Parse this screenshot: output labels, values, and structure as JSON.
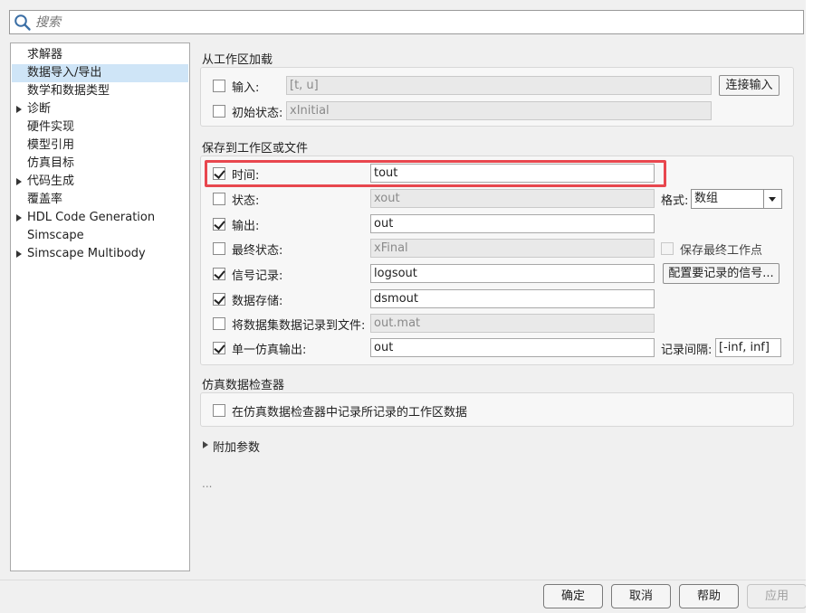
{
  "search": {
    "placeholder": "搜索"
  },
  "tree": {
    "items": [
      {
        "label": "求解器",
        "expandable": false,
        "selected": false
      },
      {
        "label": "数据导入/导出",
        "expandable": false,
        "selected": true
      },
      {
        "label": "数学和数据类型",
        "expandable": false,
        "selected": false
      },
      {
        "label": "诊断",
        "expandable": true,
        "selected": false
      },
      {
        "label": "硬件实现",
        "expandable": false,
        "selected": false
      },
      {
        "label": "模型引用",
        "expandable": false,
        "selected": false
      },
      {
        "label": "仿真目标",
        "expandable": false,
        "selected": false
      },
      {
        "label": "代码生成",
        "expandable": true,
        "selected": false
      },
      {
        "label": "覆盖率",
        "expandable": false,
        "selected": false
      },
      {
        "label": "HDL Code Generation",
        "expandable": true,
        "selected": false
      },
      {
        "label": "Simscape",
        "expandable": false,
        "selected": false
      },
      {
        "label": "Simscape Multibody",
        "expandable": true,
        "selected": false
      }
    ]
  },
  "load_section": {
    "title": "从工作区加载",
    "input_label": "输入:",
    "input_value": "[t, u]",
    "input_checked": false,
    "connect_button": "连接输入",
    "initial_state_label": "初始状态:",
    "initial_state_value": "xInitial",
    "initial_state_checked": false
  },
  "save_section": {
    "title": "保存到工作区或文件",
    "time_label": "时间:",
    "time_value": "tout",
    "time_checked": true,
    "states_label": "状态:",
    "states_value": "xout",
    "states_checked": false,
    "format_label": "格式:",
    "format_value": "数组",
    "output_label": "输出:",
    "output_value": "out",
    "output_checked": true,
    "final_states_label": "最终状态:",
    "final_states_value": "xFinal",
    "final_states_checked": false,
    "save_final_op_label": "保存最终工作点",
    "save_final_op_checked": false,
    "signal_logging_label": "信号记录:",
    "signal_logging_value": "logsout",
    "signal_logging_checked": true,
    "configure_signals_button": "配置要记录的信号...",
    "data_stores_label": "数据存储:",
    "data_stores_value": "dsmout",
    "data_stores_checked": true,
    "log_dataset_label": "将数据集数据记录到文件:",
    "log_dataset_value": "out.mat",
    "log_dataset_checked": false,
    "single_output_label": "单一仿真输出:",
    "single_output_value": "out",
    "single_output_checked": true,
    "logging_intervals_label": "记录间隔:",
    "logging_intervals_value": "[-inf, inf]"
  },
  "sdi_section": {
    "title": "仿真数据检查器",
    "record_label": "在仿真数据检查器中记录所记录的工作区数据",
    "record_checked": false
  },
  "additional_params": {
    "label": "附加参数"
  },
  "ellipsis": "...",
  "buttons": {
    "ok": "确定",
    "cancel": "取消",
    "help": "帮助",
    "apply": "应用"
  },
  "colors": {
    "highlight": "#e8474e",
    "selection": "#cfe5f7"
  }
}
